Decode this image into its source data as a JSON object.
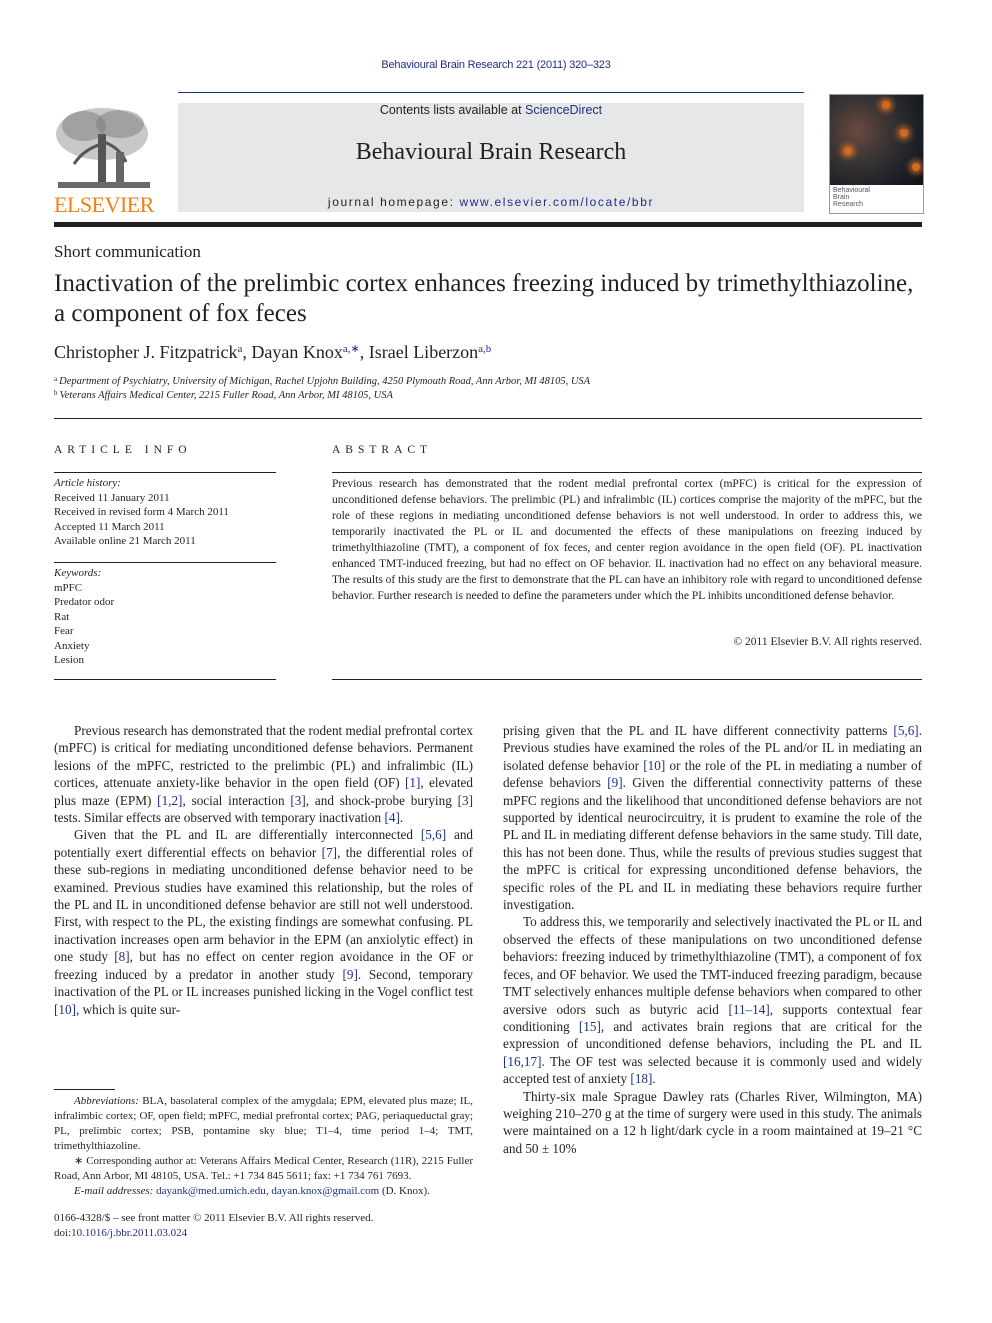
{
  "running_head": "Behavioural Brain Research 221 (2011) 320–323",
  "masthead": {
    "publisher_logo_text": "ELSEVIER",
    "contents_prefix": "Contents lists available at ",
    "contents_link": "ScienceDirect",
    "journal_title": "Behavioural Brain Research",
    "homepage_prefix": "journal homepage: ",
    "homepage_link": "www.elsevier.com/locate/bbr",
    "cover_title_lines": [
      "Behavioural",
      "Brain",
      "Research"
    ]
  },
  "article": {
    "section_type": "Short communication",
    "title": "Inactivation of the prelimbic cortex enhances freezing induced by trimethylthiazoline, a component of fox feces",
    "authors": [
      {
        "name": "Christopher J. Fitzpatrick",
        "sup": "a"
      },
      {
        "name": "Dayan Knox",
        "sup": "a,∗"
      },
      {
        "name": "Israel Liberzon",
        "sup": "a,b"
      }
    ],
    "author_separator": ", ",
    "affiliations": [
      {
        "key": "a",
        "text": "Department of Psychiatry, University of Michigan, Rachel Upjohn Building, 4250 Plymouth Road, Ann Arbor, MI 48105, USA"
      },
      {
        "key": "b",
        "text": "Veterans Affairs Medical Center, 2215 Fuller Road, Ann Arbor, MI 48105, USA"
      }
    ]
  },
  "article_info": {
    "heading": "ARTICLE INFO",
    "history_label": "Article history:",
    "history": [
      "Received 11 January 2011",
      "Received in revised form 4 March 2011",
      "Accepted 11 March 2011",
      "Available online 21 March 2011"
    ],
    "keywords_label": "Keywords:",
    "keywords": [
      "mPFC",
      "Predator odor",
      "Rat",
      "Fear",
      "Anxiety",
      "Lesion"
    ]
  },
  "abstract": {
    "heading": "ABSTRACT",
    "text": "Previous research has demonstrated that the rodent medial prefrontal cortex (mPFC) is critical for the expression of unconditioned defense behaviors. The prelimbic (PL) and infralimbic (IL) cortices comprise the majority of the mPFC, but the role of these regions in mediating unconditioned defense behaviors is not well understood. In order to address this, we temporarily inactivated the PL or IL and documented the effects of these manipulations on freezing induced by trimethylthiazoline (TMT), a component of fox feces, and center region avoidance in the open field (OF). PL inactivation enhanced TMT-induced freezing, but had no effect on OF behavior. IL inactivation had no effect on any behavioral measure. The results of this study are the first to demonstrate that the PL can have an inhibitory role with regard to unconditioned defense behavior. Further research is needed to define the parameters under which the PL inhibits unconditioned defense behavior.",
    "copyright": "© 2011 Elsevier B.V. All rights reserved."
  },
  "body": {
    "left_column": [
      {
        "indent": true,
        "segments": [
          {
            "t": "Previous research has demonstrated that the rodent medial prefrontal cortex (mPFC) is critical for mediating unconditioned defense behaviors. Permanent lesions of the mPFC, restricted to the prelimbic (PL) and infralimbic (IL) cortices, attenuate anxiety-like behavior in the open field (OF) "
          },
          {
            "t": "[1]",
            "ref": true
          },
          {
            "t": ", elevated plus maze (EPM) "
          },
          {
            "t": "[1,2]",
            "ref": true
          },
          {
            "t": ", social interaction "
          },
          {
            "t": "[3]",
            "ref": true
          },
          {
            "t": ", and shock-probe burying "
          },
          {
            "t": "[3]",
            "ref": true
          },
          {
            "t": " tests. Similar effects are observed with temporary inactivation "
          },
          {
            "t": "[4]",
            "ref": true
          },
          {
            "t": "."
          }
        ]
      },
      {
        "indent": true,
        "segments": [
          {
            "t": "Given that the PL and IL are differentially interconnected "
          },
          {
            "t": "[5,6]",
            "ref": true
          },
          {
            "t": " and potentially exert differential effects on behavior "
          },
          {
            "t": "[7]",
            "ref": true
          },
          {
            "t": ", the differential roles of these sub-regions in mediating unconditioned defense behavior need to be examined. Previous studies have examined this relationship, but the roles of the PL and IL in unconditioned defense behavior are still not well understood. First, with respect to the PL, the existing findings are somewhat confusing. PL inactivation increases open arm behavior in the EPM (an anxiolytic effect) in one study "
          },
          {
            "t": "[8]",
            "ref": true
          },
          {
            "t": ", but has no effect on center region avoidance in the OF or freezing induced by a predator in another study "
          },
          {
            "t": "[9]",
            "ref": true
          },
          {
            "t": ". Second, temporary inactivation of the PL or IL increases punished licking in the Vogel conflict test "
          },
          {
            "t": "[10]",
            "ref": true
          },
          {
            "t": ", which is quite sur-"
          }
        ]
      }
    ],
    "right_column": [
      {
        "indent": false,
        "segments": [
          {
            "t": "prising given that the PL and IL have different connectivity patterns "
          },
          {
            "t": "[5,6]",
            "ref": true
          },
          {
            "t": ". Previous studies have examined the roles of the PL and/or IL in mediating an isolated defense behavior "
          },
          {
            "t": "[10]",
            "ref": true
          },
          {
            "t": " or the role of the PL in mediating a number of defense behaviors "
          },
          {
            "t": "[9]",
            "ref": true
          },
          {
            "t": ". Given the differential connectivity patterns of these mPFC regions and the likelihood that unconditioned defense behaviors are not supported by identical neurocircuitry, it is prudent to examine the role of the PL and IL in mediating different defense behaviors in the same study. Till date, this has not been done. Thus, while the results of previous studies suggest that the mPFC is critical for expressing unconditioned defense behaviors, the specific roles of the PL and IL in mediating these behaviors require further investigation."
          }
        ]
      },
      {
        "indent": true,
        "segments": [
          {
            "t": "To address this, we temporarily and selectively inactivated the PL or IL and observed the effects of these manipulations on two unconditioned defense behaviors: freezing induced by trimethylthiazoline (TMT), a component of fox feces, and OF behavior. We used the TMT-induced freezing paradigm, because TMT selectively enhances multiple defense behaviors when compared to other aversive odors such as butyric acid "
          },
          {
            "t": "[11–14]",
            "ref": true
          },
          {
            "t": ", supports contextual fear conditioning "
          },
          {
            "t": "[15]",
            "ref": true
          },
          {
            "t": ", and activates brain regions that are critical for the expression of unconditioned defense behaviors, including the PL and IL "
          },
          {
            "t": "[16,17]",
            "ref": true
          },
          {
            "t": ". The OF test was selected because it is commonly used and widely accepted test of anxiety "
          },
          {
            "t": "[18]",
            "ref": true
          },
          {
            "t": "."
          }
        ]
      },
      {
        "indent": true,
        "segments": [
          {
            "t": "Thirty-six male Sprague Dawley rats (Charles River, Wilmington, MA) weighing 210–270 g at the time of surgery were used in this study. The animals were maintained on a 12 h light/dark cycle in a room maintained at 19–21 °C and 50 ± 10%"
          }
        ]
      }
    ]
  },
  "footnotes": {
    "abbreviations_label": "Abbreviations:",
    "abbreviations_text": " BLA, basolateral complex of the amygdala; EPM, elevated plus maze; IL, infralimbic cortex; OF, open field; mPFC, medial prefrontal cortex; PAG, periaqueductal gray; PL, prelimbic cortex; PSB, pontamine sky blue; T1–4, time period 1–4; TMT, trimethylthiazoline.",
    "corresponding": "∗ Corresponding author at: Veterans Affairs Medical Center, Research (11R), 2215 Fuller Road, Ann Arbor, MI 48105, USA. Tel.: +1 734 845 5611; fax: +1 734 761 7693.",
    "email_label": "E-mail addresses:",
    "emails": [
      "dayank@med.umich.edu",
      "dayan.knox@gmail.com"
    ],
    "email_separator": ", ",
    "email_owner": " (D. Knox)."
  },
  "front_matter": {
    "issn_line": "0166-4328/$ – see front matter © 2011 Elsevier B.V. All rights reserved.",
    "doi_prefix": "doi:",
    "doi": "10.1016/j.bbr.2011.03.024"
  },
  "colors": {
    "link": "#1d2f86",
    "elsevier_orange": "#f07f16",
    "masthead_bg": "#e6e7e8",
    "text": "#231f20"
  }
}
